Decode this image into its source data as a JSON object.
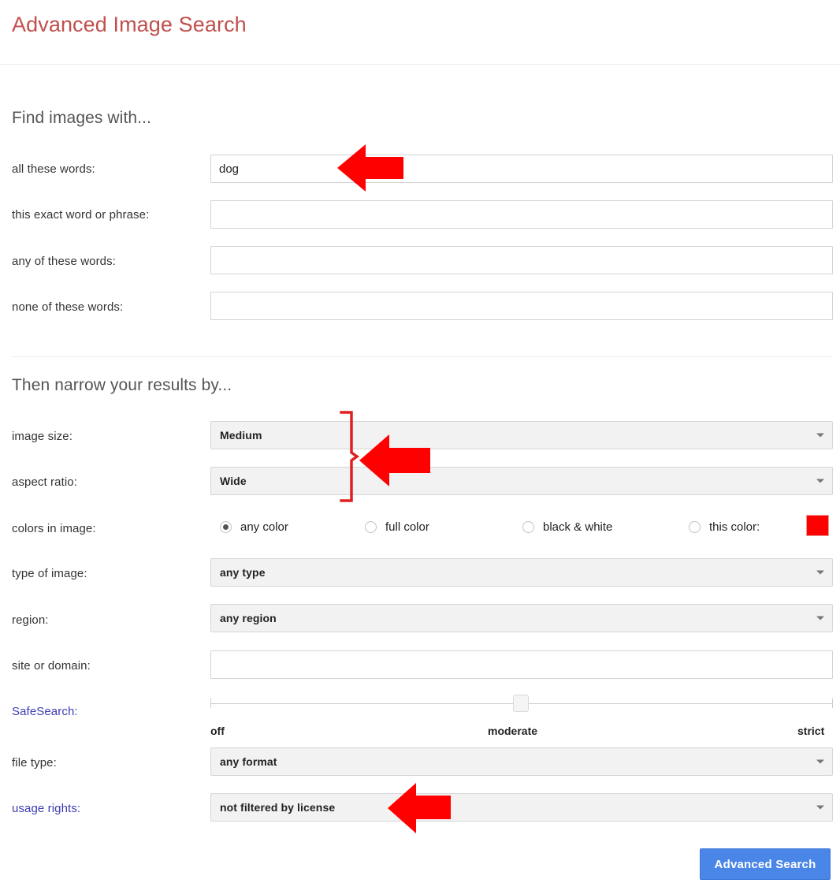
{
  "header": {
    "title": "Advanced Image Search"
  },
  "find_section": {
    "heading": "Find images with...",
    "fields": [
      {
        "label": "all these words:",
        "value": "dog",
        "placeholder": ""
      },
      {
        "label": "this exact word or phrase:",
        "value": "",
        "placeholder": ""
      },
      {
        "label": "any of these words:",
        "value": "",
        "placeholder": ""
      },
      {
        "label": "none of these words:",
        "value": "",
        "placeholder": ""
      }
    ]
  },
  "narrow_section": {
    "heading": "Then narrow your results by...",
    "image_size": {
      "label": "image size:",
      "value": "Medium"
    },
    "aspect_ratio": {
      "label": "aspect ratio:",
      "value": "Wide"
    },
    "colors_in_image": {
      "label": "colors in image:",
      "options": [
        {
          "label": "any color",
          "checked": true
        },
        {
          "label": "full color",
          "checked": false
        },
        {
          "label": "black & white",
          "checked": false
        },
        {
          "label": "this color:",
          "checked": false
        }
      ],
      "swatch_color": "#ff0000"
    },
    "type_of_image": {
      "label": "type of image:",
      "value": "any type"
    },
    "region": {
      "label": "region:",
      "value": "any region"
    },
    "site_or_domain": {
      "label": "site or domain:",
      "value": "",
      "placeholder": ""
    },
    "safesearch": {
      "label": "SafeSearch:",
      "marks": [
        "off",
        "moderate",
        "strict"
      ],
      "selected": "moderate"
    },
    "file_type": {
      "label": "file type:",
      "value": "any format"
    },
    "usage_rights": {
      "label": "usage rights:",
      "value": "not filtered by license"
    }
  },
  "submit": {
    "label": "Advanced Search"
  },
  "annotations": {
    "arrow_color": "#ff0000",
    "bracket_color": "#e02020",
    "items": [
      {
        "name": "arrow-pointing-all-these-words"
      },
      {
        "name": "bracket-grouping-size-and-ratio"
      },
      {
        "name": "arrow-pointing-size-and-ratio"
      },
      {
        "name": "arrow-pointing-usage-rights"
      }
    ]
  },
  "colors": {
    "title": "#c0504d",
    "link": "#3c3cb4",
    "button": "#4a86e8"
  }
}
